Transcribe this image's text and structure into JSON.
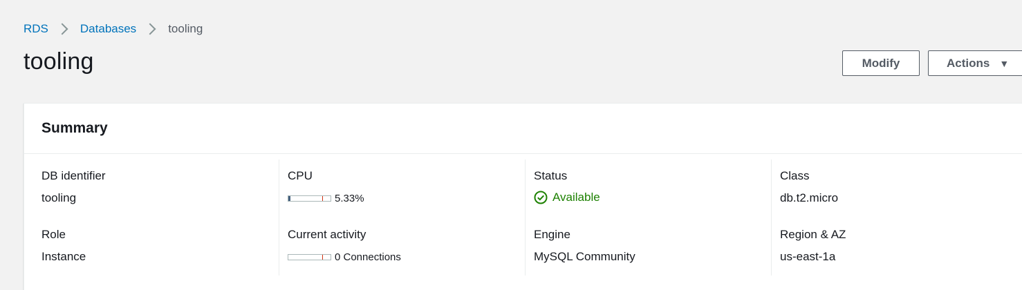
{
  "breadcrumb": {
    "items": [
      {
        "label": "RDS"
      },
      {
        "label": "Databases"
      },
      {
        "label": "tooling"
      }
    ]
  },
  "header": {
    "title": "tooling",
    "modify_label": "Modify",
    "actions_label": "Actions"
  },
  "summary": {
    "title": "Summary",
    "fields": {
      "db_identifier": {
        "label": "DB identifier",
        "value": "tooling"
      },
      "cpu": {
        "label": "CPU",
        "value": "5.33%",
        "fill_fraction": 0.0533
      },
      "status": {
        "label": "Status",
        "value": "Available",
        "color": "#1d8102"
      },
      "class": {
        "label": "Class",
        "value": "db.t2.micro"
      },
      "role": {
        "label": "Role",
        "value": "Instance"
      },
      "current_activity": {
        "label": "Current activity",
        "value": "0 Connections",
        "fill_fraction": 0
      },
      "engine": {
        "label": "Engine",
        "value": "MySQL Community"
      },
      "region_az": {
        "label": "Region & AZ",
        "value": "us-east-1a"
      }
    }
  },
  "colors": {
    "link": "#0073bb",
    "status_available": "#1d8102",
    "meter_fill": "#44607e",
    "meter_threshold": "#d13212"
  }
}
